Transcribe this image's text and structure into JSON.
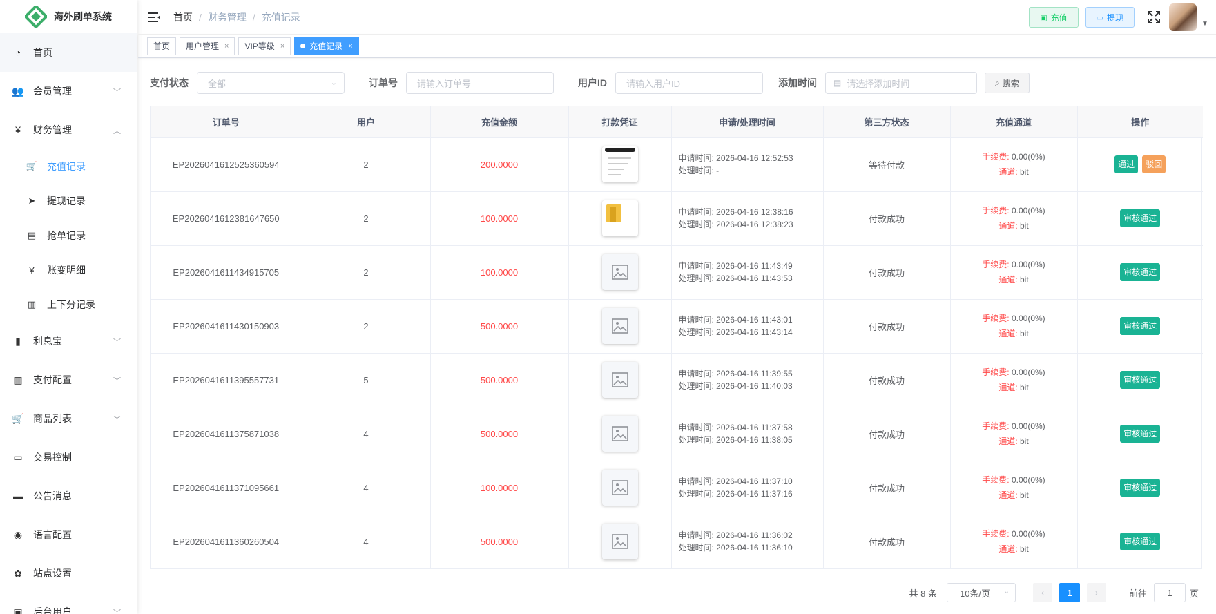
{
  "app": {
    "title": "海外刷单系统"
  },
  "colors": {
    "accent": "#409eff",
    "danger": "#ff4949",
    "success": "#1ab394",
    "warning": "#f5a15b",
    "logo_green": "#3cae6a"
  },
  "sidebar": {
    "items": [
      {
        "label": "首页",
        "icon": "dashboard-icon"
      },
      {
        "label": "会员管理",
        "icon": "users-icon",
        "expandable": true
      },
      {
        "label": "财务管理",
        "icon": "yen-icon",
        "expanded": true
      }
    ],
    "finance_sub": [
      {
        "label": "充值记录",
        "icon": "cart-icon",
        "active": true
      },
      {
        "label": "提现记录",
        "icon": "send-icon"
      },
      {
        "label": "抢单记录",
        "icon": "document-icon"
      },
      {
        "label": "账变明细",
        "icon": "yen-icon"
      },
      {
        "label": "上下分记录",
        "icon": "ledger-icon"
      }
    ],
    "items_after": [
      {
        "label": "利息宝",
        "icon": "bar-chart-icon"
      },
      {
        "label": "支付配置",
        "icon": "ledger-icon"
      },
      {
        "label": "商品列表",
        "icon": "cart-icon"
      },
      {
        "label": "交易控制",
        "icon": "monitor-icon"
      },
      {
        "label": "公告消息",
        "icon": "message-icon"
      },
      {
        "label": "语言配置",
        "icon": "globe-icon"
      },
      {
        "label": "站点设置",
        "icon": "gear-icon"
      },
      {
        "label": "后台用户",
        "icon": "user-admin-icon"
      }
    ]
  },
  "header": {
    "breadcrumb": [
      "首页",
      "财务管理",
      "充值记录"
    ],
    "recharge_label": "充值",
    "withdraw_label": "提现"
  },
  "tags": [
    {
      "label": "首页"
    },
    {
      "label": "用户管理"
    },
    {
      "label": "VIP等级"
    },
    {
      "label": "充值记录",
      "active": true
    }
  ],
  "filter": {
    "status_label": "支付状态",
    "status_value": "全部",
    "order_label": "订单号",
    "order_placeholder": "请输入订单号",
    "userid_label": "用户ID",
    "userid_placeholder": "请输入用户ID",
    "time_label": "添加时间",
    "time_placeholder": "请选择添加时间",
    "search_label": "搜索"
  },
  "table": {
    "headers": [
      "订单号",
      "用户",
      "充值金额",
      "打款凭证",
      "申请/处理时间",
      "第三方状态",
      "充值通道",
      "操作"
    ],
    "apply_prefix": "申请时间: ",
    "process_prefix": "处理时间: ",
    "fee_label": "手续费:",
    "channel_label": "通道:",
    "approve_label": "通过",
    "reject_label": "驳回",
    "approved_label": "审核通过",
    "rows": [
      {
        "order": "EP2026041612525360594",
        "user": "2",
        "amount": "200.0000",
        "voucher": "doc",
        "apply": "申请时间: 2026-04-16 12:52:53",
        "process": "处理时间: -",
        "status": "等待付款",
        "fee": "0.00(0%)",
        "channel": "bit",
        "pending": true
      },
      {
        "order": "EP2026041612381647650",
        "user": "2",
        "amount": "100.0000",
        "voucher": "folder",
        "apply": "申请时间: 2026-04-16 12:38:16",
        "process": "处理时间: 2026-04-16 12:38:23",
        "status": "付款成功",
        "fee": "0.00(0%)",
        "channel": "bit"
      },
      {
        "order": "EP2026041611434915705",
        "user": "2",
        "amount": "100.0000",
        "voucher": "placeholder",
        "apply": "申请时间: 2026-04-16 11:43:49",
        "process": "处理时间: 2026-04-16 11:43:53",
        "status": "付款成功",
        "fee": "0.00(0%)",
        "channel": "bit"
      },
      {
        "order": "EP2026041611430150903",
        "user": "2",
        "amount": "500.0000",
        "voucher": "placeholder",
        "apply": "申请时间: 2026-04-16 11:43:01",
        "process": "处理时间: 2026-04-16 11:43:14",
        "status": "付款成功",
        "fee": "0.00(0%)",
        "channel": "bit"
      },
      {
        "order": "EP2026041611395557731",
        "user": "5",
        "amount": "500.0000",
        "voucher": "placeholder",
        "apply": "申请时间: 2026-04-16 11:39:55",
        "process": "处理时间: 2026-04-16 11:40:03",
        "status": "付款成功",
        "fee": "0.00(0%)",
        "channel": "bit"
      },
      {
        "order": "EP2026041611375871038",
        "user": "4",
        "amount": "500.0000",
        "voucher": "placeholder",
        "apply": "申请时间: 2026-04-16 11:37:58",
        "process": "处理时间: 2026-04-16 11:38:05",
        "status": "付款成功",
        "fee": "0.00(0%)",
        "channel": "bit"
      },
      {
        "order": "EP2026041611371095661",
        "user": "4",
        "amount": "100.0000",
        "voucher": "placeholder",
        "apply": "申请时间: 2026-04-16 11:37:10",
        "process": "处理时间: 2026-04-16 11:37:16",
        "status": "付款成功",
        "fee": "0.00(0%)",
        "channel": "bit"
      },
      {
        "order": "EP2026041611360260504",
        "user": "4",
        "amount": "500.0000",
        "voucher": "placeholder",
        "apply": "申请时间: 2026-04-16 11:36:02",
        "process": "处理时间: 2026-04-16 11:36:10",
        "status": "付款成功",
        "fee": "0.00(0%)",
        "channel": "bit"
      }
    ]
  },
  "pagination": {
    "total": "共 8 条",
    "page_size": "10条/页",
    "current_page": "1",
    "goto_prefix": "前往",
    "goto_value": "1",
    "goto_suffix": "页"
  }
}
